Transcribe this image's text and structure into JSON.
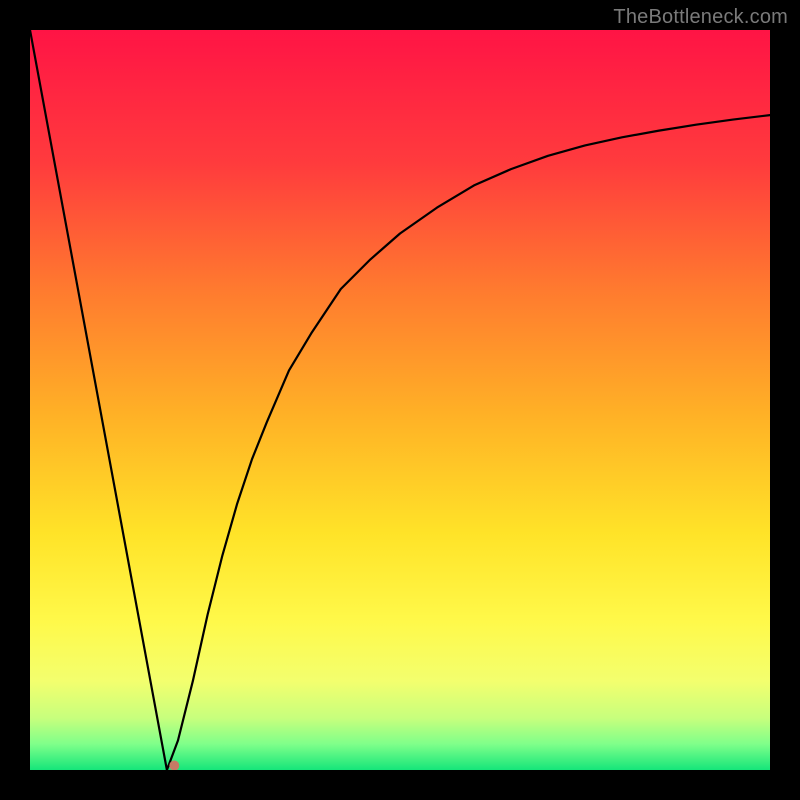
{
  "watermark": {
    "text": "TheBottleneck.com"
  },
  "chart_data": {
    "type": "line",
    "title": "",
    "xlabel": "",
    "ylabel": "",
    "xlim": [
      0,
      100
    ],
    "ylim": [
      0,
      100
    ],
    "grid": false,
    "series": [
      {
        "name": "curve",
        "x": [
          0,
          18.5,
          20,
          22,
          24,
          26,
          28,
          30,
          32,
          35,
          38,
          42,
          46,
          50,
          55,
          60,
          65,
          70,
          75,
          80,
          85,
          90,
          95,
          100
        ],
        "values": [
          100,
          0,
          4,
          12,
          21,
          29,
          36,
          42,
          47,
          54,
          59,
          65,
          69,
          72.5,
          76,
          79,
          81.2,
          83,
          84.4,
          85.5,
          86.4,
          87.2,
          87.9,
          88.5
        ]
      }
    ],
    "marker": {
      "x": 19.5,
      "y": 0.6,
      "color": "#c77a65",
      "r": 5
    },
    "background": {
      "type": "vertical-gradient",
      "stops": [
        {
          "offset": 0.0,
          "color": "#ff1445"
        },
        {
          "offset": 0.18,
          "color": "#ff3b3d"
        },
        {
          "offset": 0.35,
          "color": "#ff7a2f"
        },
        {
          "offset": 0.52,
          "color": "#ffb126"
        },
        {
          "offset": 0.68,
          "color": "#ffe328"
        },
        {
          "offset": 0.8,
          "color": "#fff94a"
        },
        {
          "offset": 0.88,
          "color": "#f3ff6e"
        },
        {
          "offset": 0.93,
          "color": "#c7ff7d"
        },
        {
          "offset": 0.965,
          "color": "#7fff8a"
        },
        {
          "offset": 1.0,
          "color": "#15e67a"
        }
      ]
    },
    "stroke": {
      "color": "#000000",
      "width": 2.2
    }
  }
}
